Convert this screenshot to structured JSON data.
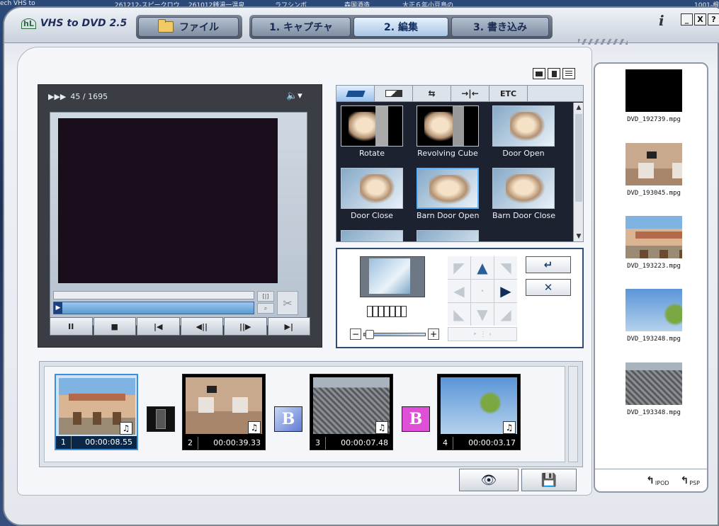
{
  "desktop": {
    "texts": [
      "ech VHS to",
      "261212-スピークロウ",
      "261012銭湯一温泉",
      "ラフシンボ",
      "森国酒造",
      "大正６年小豆島の",
      "1001-根"
    ]
  },
  "app": {
    "logo_mark": "hL",
    "title": "VHS to DVD 2.5",
    "nav": {
      "file_label": "ファイル",
      "capture_label": "1. キャプチャ",
      "edit_label": "2.  編集",
      "write_label": "3.  書き込み",
      "active": "edit"
    },
    "info_icon": "i",
    "window_buttons": [
      "_",
      "X",
      "?"
    ]
  },
  "player": {
    "frame_counter": "45 / 1695",
    "play_indicator": "▶▶▶",
    "controls": [
      "II",
      "■",
      "|◀",
      "◀||",
      "||▶",
      "▶|"
    ]
  },
  "effects": {
    "tabs": [
      "",
      "",
      "",
      "",
      "ETC"
    ],
    "items": [
      {
        "label": "Rotate"
      },
      {
        "label": "Revolving Cube"
      },
      {
        "label": "Door Open"
      },
      {
        "label": "Door Close"
      },
      {
        "label": "Barn Door Open"
      },
      {
        "label": "Barn Door Close"
      }
    ],
    "selected": "Barn Door Open"
  },
  "effect_controls": {
    "ok_icon": "↵",
    "cancel_icon": "✕",
    "minus": "−",
    "plus": "+",
    "directions": [
      "◤",
      "▲",
      "◥",
      "◀",
      "·",
      "▶",
      "◣",
      "▼",
      "◢"
    ],
    "direction_bottom": "‣ ⋮ ‹"
  },
  "storyboard": {
    "clips": [
      {
        "index": "1",
        "duration": "00:00:08.55",
        "note": "♫"
      },
      {
        "index": "2",
        "duration": "00:00:39.33",
        "note": "♫"
      },
      {
        "index": "3",
        "duration": "00:00:07.48",
        "note": "♫"
      },
      {
        "index": "4",
        "duration": "00:00:03.17",
        "note": "♫"
      }
    ],
    "transitions": [
      "",
      "B",
      "B"
    ]
  },
  "bottom_buttons": {
    "preview_icon": "👁",
    "save_icon": "💾"
  },
  "sidebar": {
    "files": [
      {
        "name": "DVD_192739.mpg"
      },
      {
        "name": "DVD_193045.mpg"
      },
      {
        "name": "DVD_193223.mpg"
      },
      {
        "name": "DVD_193248.mpg"
      },
      {
        "name": "DVD_193348.mpg"
      }
    ],
    "export_ipod": "IPOD",
    "export_psp": "PSP"
  }
}
